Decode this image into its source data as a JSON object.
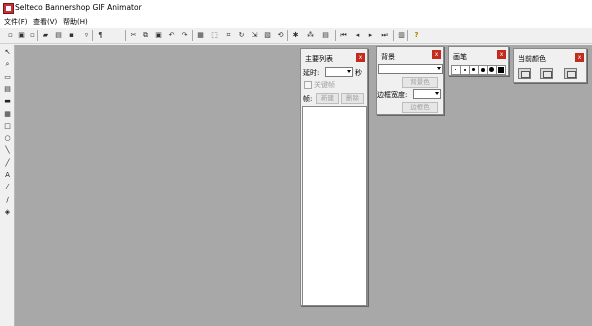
{
  "window": {
    "title": "Selteco Bannershop GIF Animator"
  },
  "menu": [
    {
      "label": "文件(F)"
    },
    {
      "label": "查看(V)"
    },
    {
      "label": "帮助(H)"
    }
  ],
  "toolbar": {
    "buttons": [
      {
        "name": "new-icon",
        "glyph": "▫"
      },
      {
        "name": "new-wizard-icon",
        "glyph": "▣"
      },
      {
        "name": "new-blank-icon",
        "glyph": "▫"
      },
      {
        "name": "open-icon",
        "glyph": "▰"
      },
      {
        "name": "import-icon",
        "glyph": "▤"
      },
      {
        "name": "save-icon",
        "glyph": "▪"
      },
      {
        "name": "filter-icon",
        "glyph": "▿"
      },
      {
        "name": "text-icon",
        "glyph": "¶"
      },
      {
        "name": "cut-icon",
        "glyph": "✂"
      },
      {
        "name": "copy-icon",
        "glyph": "⧉"
      },
      {
        "name": "paste-icon",
        "glyph": "▣"
      },
      {
        "name": "undo-icon",
        "glyph": "↶"
      },
      {
        "name": "redo-icon",
        "glyph": "↷"
      },
      {
        "name": "grid-icon",
        "glyph": "▦"
      },
      {
        "name": "select-all-icon",
        "glyph": "⬚"
      },
      {
        "name": "crop-icon",
        "glyph": "⌗"
      },
      {
        "name": "rotate-icon",
        "glyph": "↻"
      },
      {
        "name": "resize-icon",
        "glyph": "⇲"
      },
      {
        "name": "image-icon",
        "glyph": "▧"
      },
      {
        "name": "loop-icon",
        "glyph": "⟲"
      },
      {
        "name": "effect-icon",
        "glyph": "✱"
      },
      {
        "name": "wand-icon",
        "glyph": "⁂"
      },
      {
        "name": "frames-icon",
        "glyph": "▤"
      },
      {
        "name": "first-frame-icon",
        "glyph": "⏮"
      },
      {
        "name": "prev-frame-icon",
        "glyph": "◂"
      },
      {
        "name": "next-frame-icon",
        "glyph": "▸"
      },
      {
        "name": "last-frame-icon",
        "glyph": "⏭"
      },
      {
        "name": "delete-icon",
        "glyph": "▥"
      },
      {
        "name": "help-icon",
        "glyph": "?"
      }
    ]
  },
  "tools": [
    {
      "name": "pointer-tool-icon",
      "glyph": "↖"
    },
    {
      "name": "zoom-tool-icon",
      "glyph": "⌕"
    },
    {
      "name": "rectangle-select-icon",
      "glyph": "▭"
    },
    {
      "name": "gradient-icon",
      "glyph": "▤"
    },
    {
      "name": "fill-rect-icon",
      "glyph": "▬"
    },
    {
      "name": "pattern-icon",
      "glyph": "▦"
    },
    {
      "name": "rectangle-tool-icon",
      "glyph": "□"
    },
    {
      "name": "ellipse-tool-icon",
      "glyph": "○"
    },
    {
      "name": "line-tool-icon",
      "glyph": "╲"
    },
    {
      "name": "pencil-tool-icon",
      "glyph": "╱"
    },
    {
      "name": "text-tool-icon",
      "glyph": "A"
    },
    {
      "name": "eyedropper-tool-icon",
      "glyph": "⁄"
    },
    {
      "name": "brush-tool-icon",
      "glyph": "∕"
    },
    {
      "name": "bucket-tool-icon",
      "glyph": "◈"
    }
  ],
  "panels": {
    "main_list": {
      "title": "主要列表",
      "close": "x",
      "delay_label": "延时:",
      "delay_value": "",
      "delay_unit": "秒",
      "keyframe_label": "关键帧",
      "frame_label": "帧:",
      "new_label": "新建",
      "delete_label": "删除"
    },
    "background": {
      "title": "背景",
      "close": "x",
      "bg_color_label": "背景色",
      "border_width_label": "边框宽度:",
      "border_color_label": "边框色"
    },
    "brush": {
      "title": "画笔",
      "close": "x"
    },
    "current_color": {
      "title": "当前颜色",
      "close": "x"
    }
  },
  "colors": {
    "workspace": "#a8a8a8",
    "close_button": "#c42b1c",
    "panel": "#f0f0f0"
  }
}
